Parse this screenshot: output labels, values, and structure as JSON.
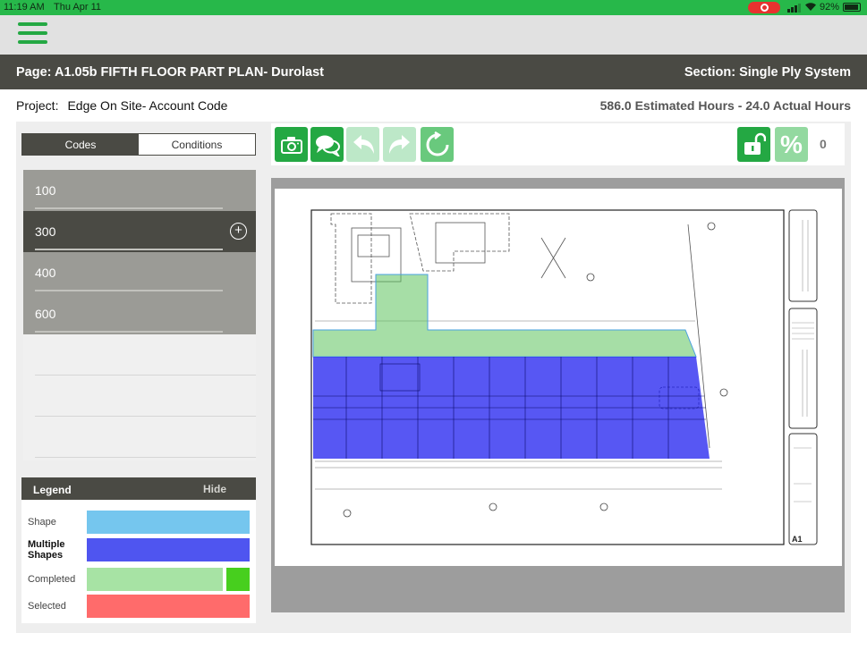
{
  "status_bar": {
    "time": "11:19 AM",
    "date": "Thu Apr 11",
    "battery": "92%"
  },
  "page_bar": {
    "page": "Page: A1.05b FIFTH FLOOR PART PLAN- Durolast",
    "section": "Section: Single Ply System"
  },
  "project_bar": {
    "label": "Project:",
    "name": "Edge On Site- Account Code",
    "hours": "586.0 Estimated Hours - 24.0 Actual Hours"
  },
  "tabs": {
    "codes": "Codes",
    "conditions": "Conditions"
  },
  "codes": [
    {
      "label": "100"
    },
    {
      "label": "300",
      "selected": true
    },
    {
      "label": "400"
    },
    {
      "label": "600"
    }
  ],
  "legend": {
    "title": "Legend",
    "hide": "Hide",
    "items": [
      {
        "label": "Shape",
        "color": "#75c6ee"
      },
      {
        "label": "Multiple Shapes",
        "color": "#4f55f0"
      },
      {
        "label": "Completed",
        "color": "#a7e3a4",
        "accent": "#47cf1e"
      },
      {
        "label": "Selected",
        "color": "#ff6b6b"
      }
    ]
  },
  "toolbar": {
    "icons": [
      "camera-icon",
      "chat-icon",
      "undo-icon",
      "redo-icon",
      "refresh-icon",
      "unlock-icon",
      "percent-icon"
    ],
    "percent_symbol": "%",
    "count": "0"
  },
  "colors": {
    "brand_green": "#24a843",
    "header_dark": "#4a4a44",
    "plan_green": "#5cc35c",
    "plan_blue": "#1616ee"
  }
}
